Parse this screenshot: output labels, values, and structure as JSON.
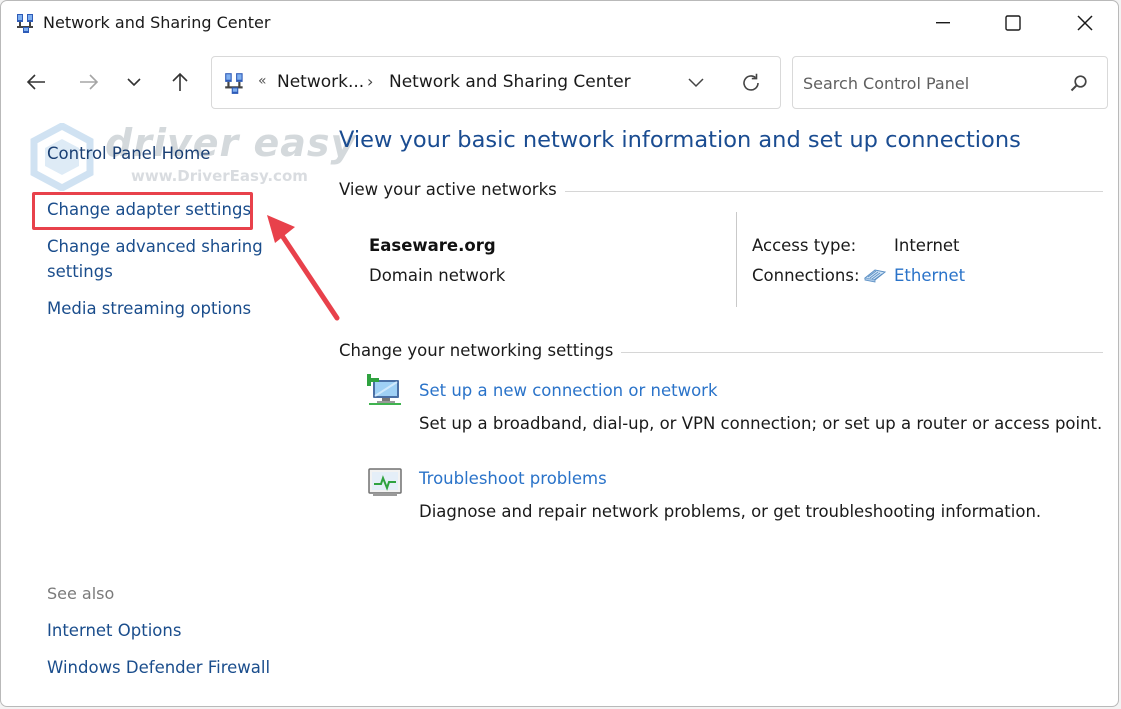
{
  "window": {
    "title": "Network and Sharing Center"
  },
  "nav": {
    "crumb_prefix": "«",
    "crumb_parent": "Network...",
    "crumb_sep": "›",
    "crumb_current": "Network and Sharing Center",
    "search_placeholder": "Search Control Panel"
  },
  "watermark": {
    "brand": "driver easy",
    "url": "www.DriverEasy.com"
  },
  "left_pane": {
    "home": "Control Panel Home",
    "adapter": "Change adapter settings",
    "advanced_line1": "Change advanced sharing",
    "advanced_line2": "settings",
    "media": "Media streaming options",
    "see_also": "See also",
    "internet_options": "Internet Options",
    "firewall": "Windows Defender Firewall"
  },
  "main": {
    "title": "View your basic network information and set up connections",
    "active_networks_heading": "View your active networks",
    "network_name": "Easeware.org",
    "network_category": "Domain network",
    "access_type_label": "Access type:",
    "access_type_value": "Internet",
    "connections_label": "Connections:",
    "connections_value": "Ethernet",
    "change_heading": "Change your networking settings",
    "tasks": [
      {
        "link": "Set up a new connection or network",
        "desc": "Set up a broadband, dial-up, or VPN connection; or set up a router or access point.",
        "icon": "new-connection-icon"
      },
      {
        "link": "Troubleshoot problems",
        "desc": "Diagnose and repair network problems, or get troubleshooting information.",
        "icon": "troubleshoot-icon"
      }
    ]
  },
  "colors": {
    "link": "#2a73c9",
    "title": "#1a4c91",
    "annotation": "#e8414b"
  }
}
